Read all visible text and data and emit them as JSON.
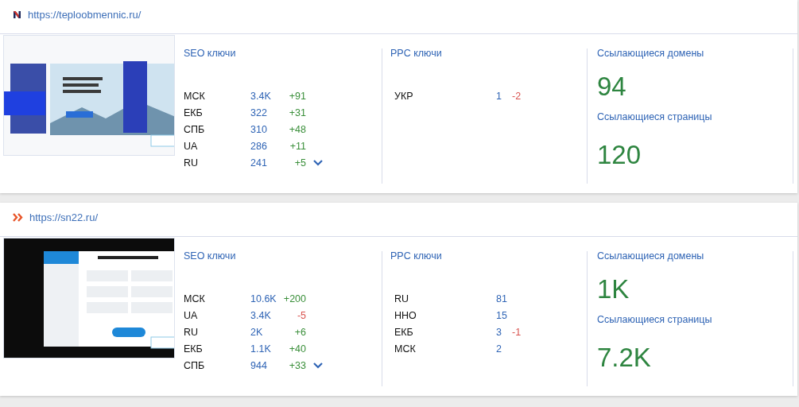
{
  "sites": [
    {
      "url": "https://teploobmennic.ru/",
      "logo": {
        "kind": "letter"
      },
      "thumbnail": {
        "kind": "light"
      },
      "seo": {
        "title": "SEO ключи",
        "rows": [
          {
            "region": "МСК",
            "count": "3.4K",
            "change": "+91",
            "negative": false
          },
          {
            "region": "ЕКБ",
            "count": "322",
            "change": "+31",
            "negative": false
          },
          {
            "region": "СПБ",
            "count": "310",
            "change": "+48",
            "negative": false
          },
          {
            "region": "UA",
            "count": "286",
            "change": "+11",
            "negative": false
          },
          {
            "region": "RU",
            "count": "241",
            "change": "+5",
            "negative": false
          }
        ]
      },
      "ppc": {
        "title": "PPC ключи",
        "rows": [
          {
            "region": "УКР",
            "count": "1",
            "change": "-2",
            "negative": true
          }
        ]
      },
      "domains": {
        "title": "Ссылающиеся домены",
        "value": "94"
      },
      "pages": {
        "title": "Ссылающиеся страницы",
        "value": "120"
      }
    },
    {
      "url": "https://sn22.ru/",
      "logo": {
        "kind": "chevrons"
      },
      "thumbnail": {
        "kind": "dark"
      },
      "seo": {
        "title": "SEO ключи",
        "rows": [
          {
            "region": "МСК",
            "count": "10.6K",
            "change": "+200",
            "negative": false
          },
          {
            "region": "UA",
            "count": "3.4K",
            "change": "-5",
            "negative": true
          },
          {
            "region": "RU",
            "count": "2K",
            "change": "+6",
            "negative": false
          },
          {
            "region": "ЕКБ",
            "count": "1.1K",
            "change": "+40",
            "negative": false
          },
          {
            "region": "СПБ",
            "count": "944",
            "change": "+33",
            "negative": false
          }
        ]
      },
      "ppc": {
        "title": "PPC ключи",
        "rows": [
          {
            "region": "RU",
            "count": "81"
          },
          {
            "region": "ННО",
            "count": "15"
          },
          {
            "region": "ЕКБ",
            "count": "3",
            "change": "-1",
            "negative": true
          },
          {
            "region": "МСК",
            "count": "2"
          }
        ]
      },
      "domains": {
        "title": "Ссылающиеся домены",
        "value": "1K"
      },
      "pages": {
        "title": "Ссылающиеся страницы",
        "value": "7.2K"
      }
    }
  ]
}
